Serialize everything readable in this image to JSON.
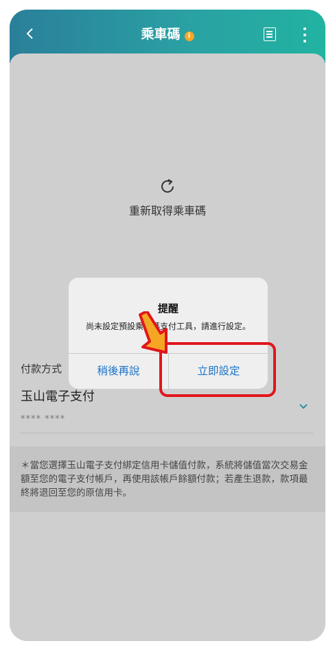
{
  "header": {
    "back_icon": "chevron-left-icon",
    "title": "乘車碼",
    "info_icon": "info-icon",
    "info_glyph": "i",
    "list_icon": "list-icon",
    "more_icon": "more-vertical-icon"
  },
  "main": {
    "refresh_icon": "refresh-icon",
    "refresh_label": "重新取得乘車碼",
    "payment_label": "付款方式",
    "payment_value": "玉山電子支付",
    "card_mask": "**** ****",
    "notice": "＊當您選擇玉山電子支付綁定信用卡儲值付款，系統將儲值當次交易金額至您的電子支付帳戶，再使用該帳戶餘額付款；若產生退款，款項最終將退回至您的原信用卡。"
  },
  "dialog": {
    "title": "提醒",
    "message": "尚未設定預設乘車碼支付工具，請進行設定。",
    "later_label": "稍後再說",
    "now_label": "立即設定"
  },
  "colors": {
    "header_start": "#2a7f9a",
    "header_end": "#22b3a2",
    "link": "#1a73c8",
    "highlight": "#e0161c",
    "arrow": "#f5a623"
  }
}
